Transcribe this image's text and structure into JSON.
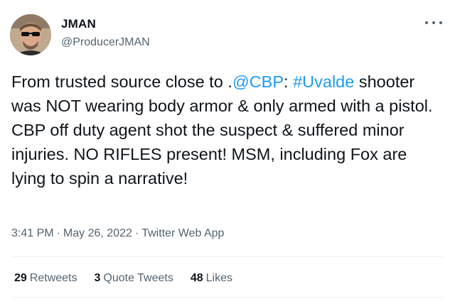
{
  "author": {
    "display_name": "JMAN",
    "handle": "@ProducerJMAN",
    "avatar_icon": "user-avatar"
  },
  "more_icon": "more-options-icon",
  "tweet": {
    "segments": [
      {
        "text": "From trusted source close to .",
        "type": "text"
      },
      {
        "text": "@CBP",
        "type": "mention"
      },
      {
        "text": ": ",
        "type": "text"
      },
      {
        "text": "#Uvalde",
        "type": "hashtag"
      },
      {
        "text": " shooter was NOT wearing body armor & only armed with a pistol. CBP off duty agent shot the suspect & suffered minor injuries. NO RIFLES present! MSM, including Fox are lying to spin a narrative!",
        "type": "text"
      }
    ]
  },
  "meta": {
    "time": "3:41 PM",
    "separator": "·",
    "date": "May 26, 2022",
    "source": "Twitter Web App"
  },
  "stats": {
    "retweets_count": "29",
    "retweets_label": "Retweets",
    "quotes_count": "3",
    "quotes_label": "Quote Tweets",
    "likes_count": "48",
    "likes_label": "Likes"
  },
  "colors": {
    "link": "#1d9bf0",
    "secondary_text": "#536471",
    "primary_text": "#0f1419"
  }
}
